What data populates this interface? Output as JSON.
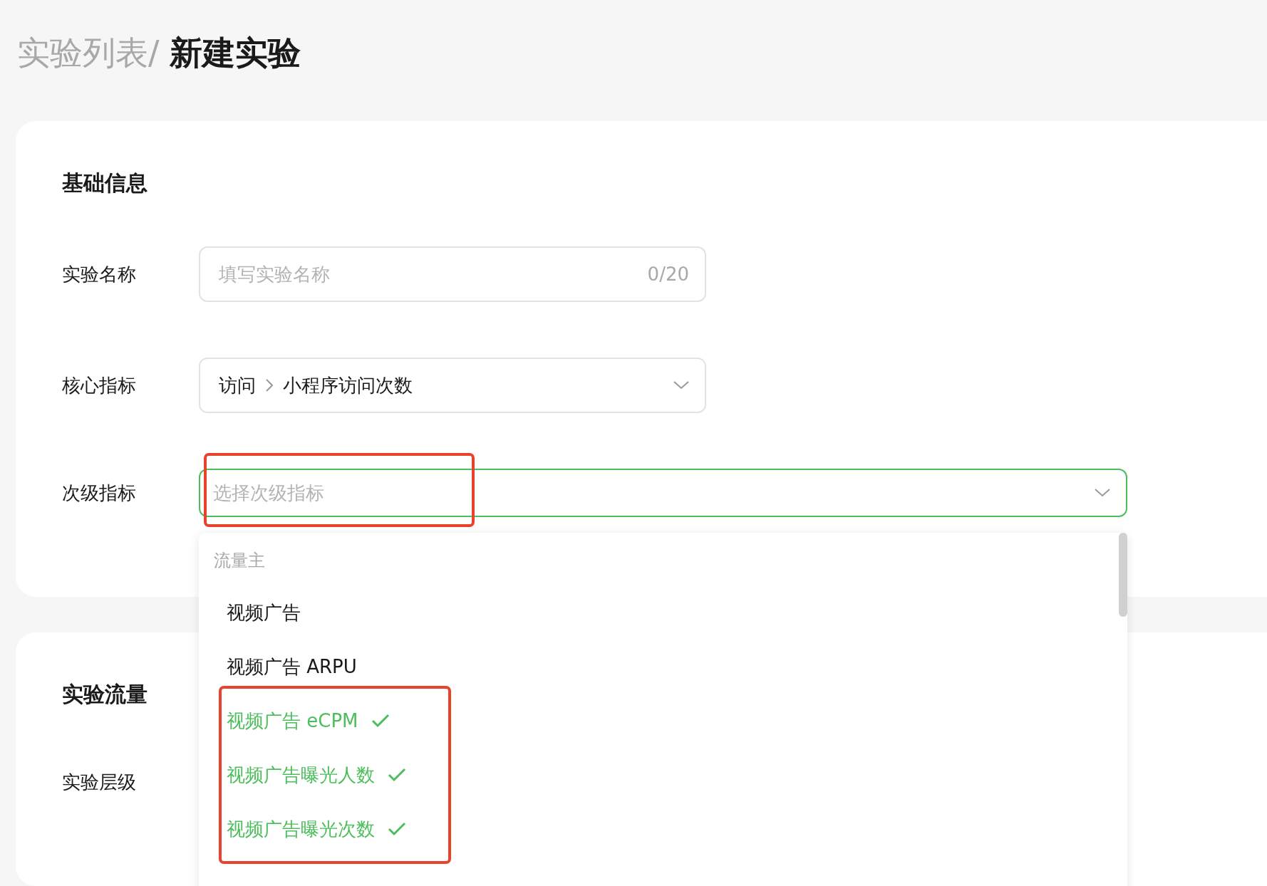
{
  "breadcrumb": {
    "parent": "实验列表/",
    "current": "新建实验"
  },
  "basic_info": {
    "title": "基础信息",
    "fields": [
      {
        "kind": "text",
        "label": "实验名称",
        "placeholder": "填写实验名称",
        "counter": "0/20"
      },
      {
        "kind": "cascader",
        "label": "核心指标",
        "path": [
          "访问",
          "小程序访问次数"
        ]
      },
      {
        "kind": "select",
        "label": "次级指标",
        "placeholder": "选择次级指标",
        "focused": true
      }
    ]
  },
  "dropdown": {
    "group": "流量主",
    "options": [
      {
        "label": "视频广告",
        "selected": false
      },
      {
        "label": "视频广告 ARPU",
        "selected": false
      },
      {
        "label": "视频广告 eCPM",
        "selected": true
      },
      {
        "label": "视频广告曝光人数",
        "selected": true
      },
      {
        "label": "视频广告曝光次数",
        "selected": true
      }
    ]
  },
  "traffic": {
    "title": "实验流量",
    "fields": [
      {
        "label": "实验层级"
      }
    ]
  }
}
